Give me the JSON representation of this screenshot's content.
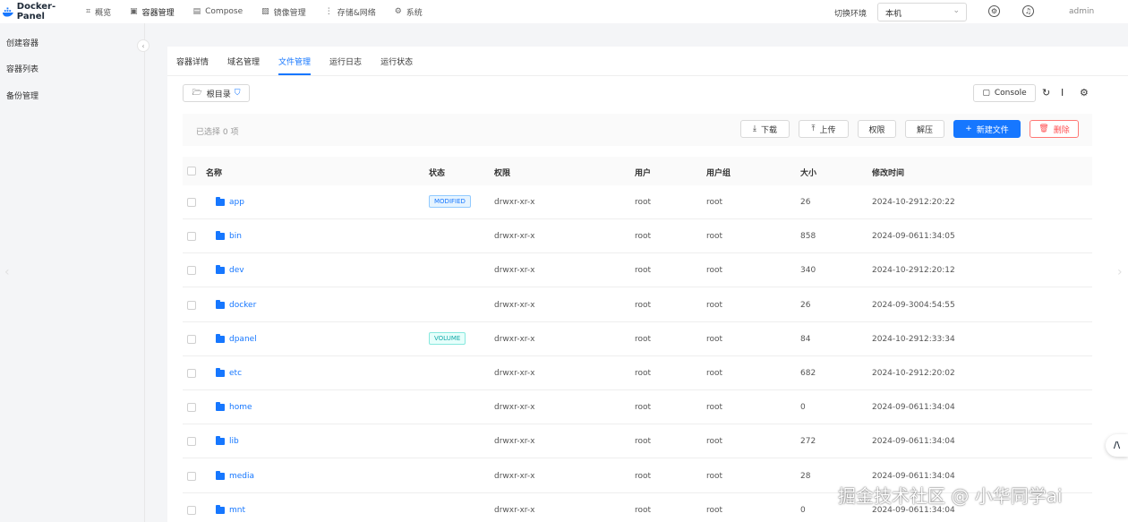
{
  "app": {
    "title": "Docker-Panel",
    "brand_color": "#1677ff"
  },
  "nav": {
    "items": [
      {
        "label": "概览",
        "icon": "chart-icon"
      },
      {
        "label": "容器管理",
        "icon": "container-icon"
      },
      {
        "label": "Compose",
        "icon": "compose-icon"
      },
      {
        "label": "镜像管理",
        "icon": "image-icon"
      },
      {
        "label": "存储&网络",
        "icon": "storage-icon"
      },
      {
        "label": "系统",
        "icon": "gear-icon"
      }
    ],
    "env_label": "切换环境",
    "env_value": "本机",
    "user": "admin"
  },
  "sidebar": {
    "items": [
      {
        "label": "创建容器"
      },
      {
        "label": "容器列表"
      },
      {
        "label": "备份管理"
      }
    ]
  },
  "tabs": [
    {
      "label": "容器详情"
    },
    {
      "label": "域名管理"
    },
    {
      "label": "文件管理",
      "active": true
    },
    {
      "label": "运行日志"
    },
    {
      "label": "运行状态"
    }
  ],
  "toolbar": {
    "root_dir": "根目录",
    "console": "Console",
    "selected": "已选择 0 项",
    "download": "下载",
    "upload": "上传",
    "permission": "权限",
    "extract": "解压",
    "new_file": "新建文件",
    "delete": "删除"
  },
  "table": {
    "headers": [
      "名称",
      "状态",
      "权限",
      "用户",
      "用户组",
      "大小",
      "修改时间"
    ],
    "rows": [
      {
        "name": "app",
        "status": "MODIFIED",
        "perm": "drwxr-xr-x",
        "user": "root",
        "group": "root",
        "size": "26",
        "mtime": "2024-10-2912:20:22"
      },
      {
        "name": "bin",
        "status": "",
        "perm": "drwxr-xr-x",
        "user": "root",
        "group": "root",
        "size": "858",
        "mtime": "2024-09-0611:34:05"
      },
      {
        "name": "dev",
        "status": "",
        "perm": "drwxr-xr-x",
        "user": "root",
        "group": "root",
        "size": "340",
        "mtime": "2024-10-2912:20:12"
      },
      {
        "name": "docker",
        "status": "",
        "perm": "drwxr-xr-x",
        "user": "root",
        "group": "root",
        "size": "26",
        "mtime": "2024-09-3004:54:55"
      },
      {
        "name": "dpanel",
        "status": "VOLUME",
        "perm": "drwxr-xr-x",
        "user": "root",
        "group": "root",
        "size": "84",
        "mtime": "2024-10-2912:33:34"
      },
      {
        "name": "etc",
        "status": "",
        "perm": "drwxr-xr-x",
        "user": "root",
        "group": "root",
        "size": "682",
        "mtime": "2024-10-2912:20:02"
      },
      {
        "name": "home",
        "status": "",
        "perm": "drwxr-xr-x",
        "user": "root",
        "group": "root",
        "size": "0",
        "mtime": "2024-09-0611:34:04"
      },
      {
        "name": "lib",
        "status": "",
        "perm": "drwxr-xr-x",
        "user": "root",
        "group": "root",
        "size": "272",
        "mtime": "2024-09-0611:34:04"
      },
      {
        "name": "media",
        "status": "",
        "perm": "drwxr-xr-x",
        "user": "root",
        "group": "root",
        "size": "28",
        "mtime": "2024-09-0611:34:04"
      },
      {
        "name": "mnt",
        "status": "",
        "perm": "drwxr-xr-x",
        "user": "root",
        "group": "root",
        "size": "0",
        "mtime": "2024-09-0611:34:04"
      }
    ]
  },
  "watermark": "掘金技术社区 @ 小华同学ai"
}
